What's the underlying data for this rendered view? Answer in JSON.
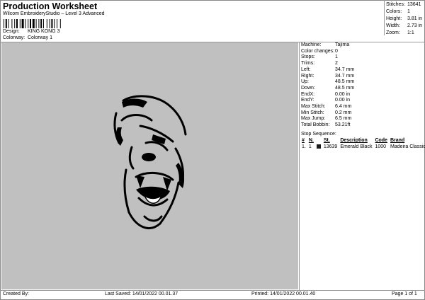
{
  "header": {
    "title": "Production Worksheet",
    "subtitle": "Wilcom EmbroideryStudio – Level 3 Advanced",
    "design_label": "Design:",
    "design_value": "KING KONG 3",
    "colorway_label": "Colorway:",
    "colorway_value": "Colorway 1"
  },
  "summary": [
    {
      "label": "Stitches:",
      "value": "13641"
    },
    {
      "label": "Colors:",
      "value": "1"
    },
    {
      "label": "Height:",
      "value": "3.81 in"
    },
    {
      "label": "Width:",
      "value": "2.73 in"
    },
    {
      "label": "Zoom:",
      "value": "1:1"
    }
  ],
  "properties": [
    {
      "label": "Machine:",
      "value": "Tajima"
    },
    {
      "label": "Color changes:",
      "value": "0"
    },
    {
      "label": "Stops:",
      "value": "1"
    },
    {
      "label": "Trims:",
      "value": "2"
    },
    {
      "label": "Left:",
      "value": "34.7 mm"
    },
    {
      "label": "Right:",
      "value": "34.7 mm"
    },
    {
      "label": "Up:",
      "value": "48.5 mm"
    },
    {
      "label": "Down:",
      "value": "48.5 mm"
    },
    {
      "label": "EndX:",
      "value": "0.00 in"
    },
    {
      "label": "EndY:",
      "value": "0.00 in"
    },
    {
      "label": "Max Stitch:",
      "value": "6.4 mm"
    },
    {
      "label": "Min Stitch:",
      "value": "0.2 mm"
    },
    {
      "label": "Max Jump:",
      "value": "6.5 mm"
    },
    {
      "label": "Total Bobbin:",
      "value": "53.21ft"
    }
  ],
  "stop_sequence": {
    "title": "Stop Sequence:",
    "headers": [
      "#",
      "N.",
      "",
      "St.",
      "Description",
      "Code",
      "Brand"
    ],
    "rows": [
      [
        "1.",
        "1",
        "",
        "13639",
        "Emerald Black",
        "1000",
        "Madeira Classic 40"
      ]
    ],
    "swatch_color": "#1b1b1b"
  },
  "preview": {
    "background": "#c0c0c0",
    "design_name": "gorilla-head-icon"
  },
  "footer": {
    "created_by": "Created By:",
    "last_saved": "Last Saved: 14/01/2022 00.01.37",
    "printed": "Printed: 14/01/2022 00.01.40",
    "page": "Page 1 of 1"
  }
}
